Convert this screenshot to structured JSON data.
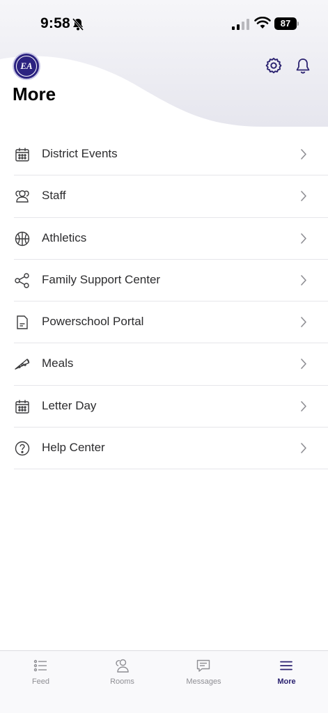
{
  "status_bar": {
    "time": "9:58",
    "battery": "87"
  },
  "header": {
    "title": "More",
    "logo_text": "EA"
  },
  "menu": {
    "items": [
      {
        "label": "District Events",
        "icon": "calendar-icon"
      },
      {
        "label": "Staff",
        "icon": "people-icon"
      },
      {
        "label": "Athletics",
        "icon": "basketball-icon"
      },
      {
        "label": "Family Support Center",
        "icon": "share-icon"
      },
      {
        "label": "Powerschool Portal",
        "icon": "document-icon"
      },
      {
        "label": "Meals",
        "icon": "pizza-icon"
      },
      {
        "label": "Letter Day",
        "icon": "calendar-icon"
      },
      {
        "label": "Help Center",
        "icon": "help-icon"
      }
    ]
  },
  "tabs": [
    {
      "label": "Feed",
      "icon": "list-icon",
      "active": false
    },
    {
      "label": "Rooms",
      "icon": "people-icon",
      "active": false
    },
    {
      "label": "Messages",
      "icon": "chat-icon",
      "active": false
    },
    {
      "label": "More",
      "icon": "menu-icon",
      "active": true
    }
  ],
  "colors": {
    "accent": "#2b2270",
    "header_gradient": "#e6e6ee",
    "inactive_tab": "#8e8e93"
  }
}
